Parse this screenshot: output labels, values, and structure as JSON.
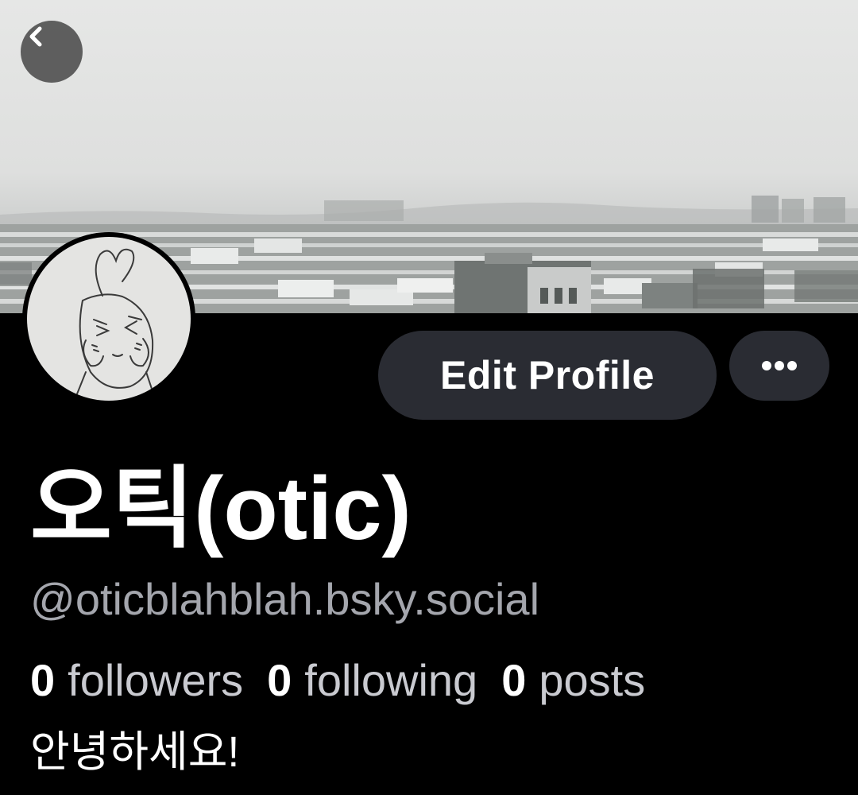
{
  "profile": {
    "display_name": "오틱(otic)",
    "handle": "@oticblahblah.bsky.social",
    "bio": "안녕하세요!",
    "stats": {
      "followers_count": "0",
      "followers_label": "followers",
      "following_count": "0",
      "following_label": "following",
      "posts_count": "0",
      "posts_label": "posts"
    }
  },
  "actions": {
    "edit_label": "Edit Profile"
  },
  "icons": {
    "back": "chevron-left-icon",
    "more": "more-horizontal-icon"
  },
  "colors": {
    "background": "#000000",
    "button_bg": "#2a2c33",
    "handle_text": "#a4a6ad"
  }
}
